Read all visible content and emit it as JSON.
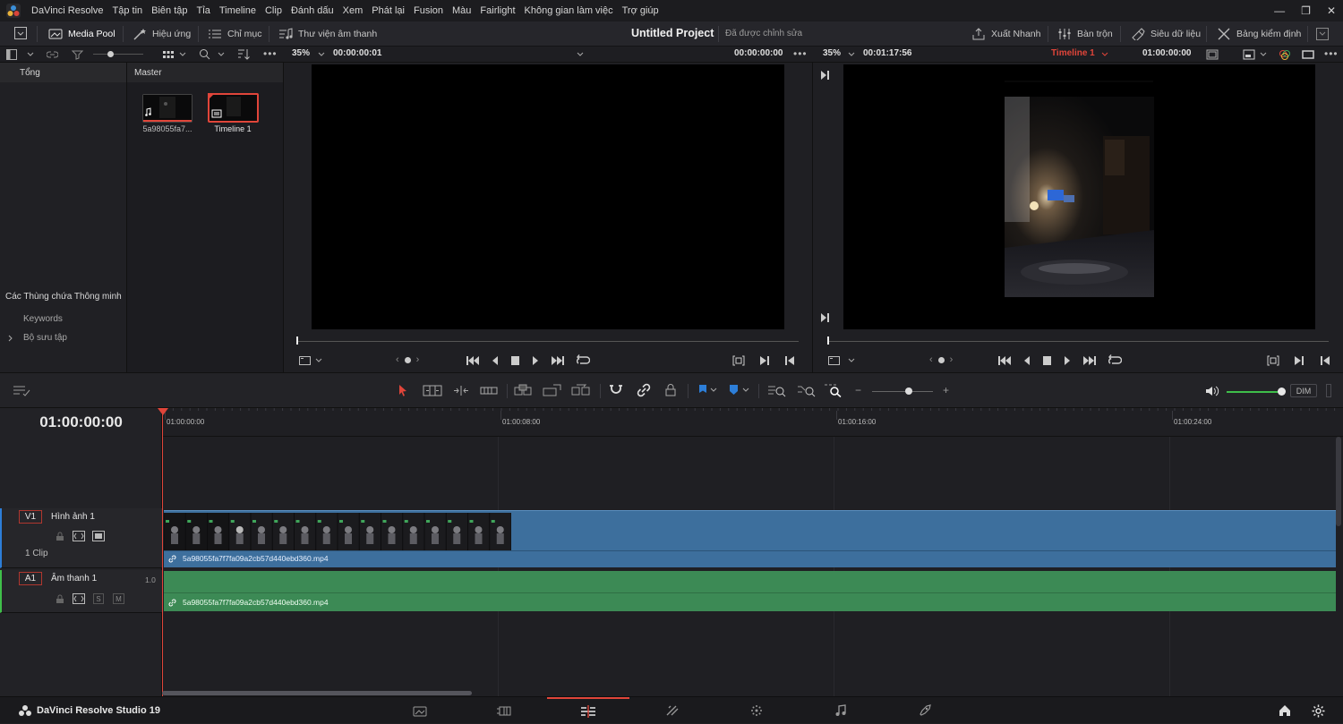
{
  "menubar": {
    "app_name": "DaVinci Resolve",
    "items": [
      "Tập tin",
      "Biên tập",
      "Tỉa",
      "Timeline",
      "Clip",
      "Đánh dấu",
      "Xem",
      "Phát lại",
      "Fusion",
      "Màu",
      "Fairlight",
      "Không gian làm việc",
      "Trợ giúp"
    ]
  },
  "toolbar": {
    "media_pool": "Media Pool",
    "effects": "Hiệu ứng",
    "index": "Chỉ mục",
    "sound_library": "Thư viện âm thanh",
    "project_title": "Untitled Project",
    "project_status": "Đã được chỉnh sửa",
    "quick_export": "Xuất Nhanh",
    "mixer": "Bàn trộn",
    "metadata": "Siêu dữ liệu",
    "inspector": "Bảng kiểm định"
  },
  "source_viewer": {
    "zoom": "35%",
    "timecode": "00:00:00:01",
    "timecode_right": "00:00:00:00"
  },
  "program_viewer": {
    "zoom": "35%",
    "duration": "00:01:17:56",
    "timeline_name": "Timeline 1",
    "timecode": "01:00:00:00"
  },
  "bins": {
    "header": "Tổng",
    "smart_bins_title": "Các Thùng chứa Thông minh",
    "keywords": "Keywords",
    "collections": "Bộ sưu tập"
  },
  "media_pool": {
    "header": "Master",
    "items": [
      {
        "name": "5a98055fa7...",
        "type": "audio-video"
      },
      {
        "name": "Timeline 1",
        "type": "timeline"
      }
    ]
  },
  "timeline": {
    "current_timecode": "01:00:00:00",
    "ruler": [
      "01:00:00:00",
      "01:00:08:00",
      "01:00:16:00",
      "01:00:24:00"
    ],
    "video_track": {
      "label": "V1",
      "name": "Hình ảnh 1",
      "clip_count": "1 Clip",
      "clip_name": "5a98055fa7f7fa09a2cb57d440ebd360.mp4"
    },
    "audio_track": {
      "label": "A1",
      "name": "Âm thanh 1",
      "level": "1.0",
      "clip_name": "5a98055fa7f7fa09a2cb57d440ebd360.mp4",
      "solo": "S",
      "mute": "M"
    },
    "dim_label": "DIM"
  },
  "footer": {
    "product": "DaVinci Resolve Studio 19",
    "pages": [
      "media-icon",
      "cut-icon",
      "edit-icon",
      "fusion-icon",
      "color-icon",
      "fairlight-icon",
      "deliver-icon"
    ],
    "active_page": 2
  },
  "colors": {
    "accent_red": "#e0453a",
    "video_clip": "#3d6f9d",
    "audio_clip": "#3c8a55",
    "timeline_name": "#e0453a"
  }
}
